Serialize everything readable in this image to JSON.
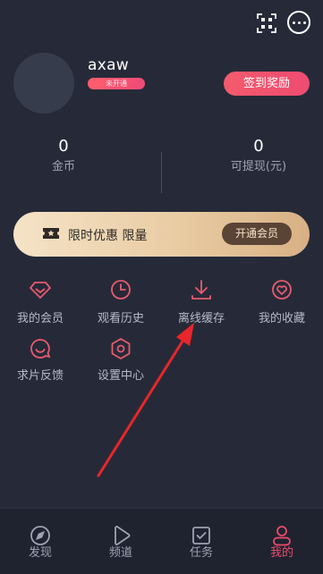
{
  "profile": {
    "username": "axaw",
    "badge": "未开通",
    "checkin_label": "签到奖励"
  },
  "stats": [
    {
      "value": "0",
      "label": "金币"
    },
    {
      "value": "0",
      "label": "可提现(元)"
    }
  ],
  "banner": {
    "text": "限时优惠 限量",
    "button_label": "开通会员"
  },
  "grid": [
    {
      "label": "我的会员",
      "icon": "diamond-icon"
    },
    {
      "label": "观看历史",
      "icon": "clock-icon"
    },
    {
      "label": "离线缓存",
      "icon": "download-icon"
    },
    {
      "label": "我的收藏",
      "icon": "heart-icon"
    },
    {
      "label": "求片反馈",
      "icon": "chat-icon"
    },
    {
      "label": "设置中心",
      "icon": "settings-icon"
    }
  ],
  "tabs": [
    {
      "label": "发现",
      "icon": "compass-icon",
      "active": false
    },
    {
      "label": "频道",
      "icon": "play-icon",
      "active": false
    },
    {
      "label": "任务",
      "icon": "task-icon",
      "active": false
    },
    {
      "label": "我的",
      "icon": "user-icon",
      "active": true
    }
  ],
  "colors": {
    "background": "#262a38",
    "accent": "#f04a6a",
    "grid_icon": "#e85b6e",
    "banner_gold": "#e9cca3"
  }
}
